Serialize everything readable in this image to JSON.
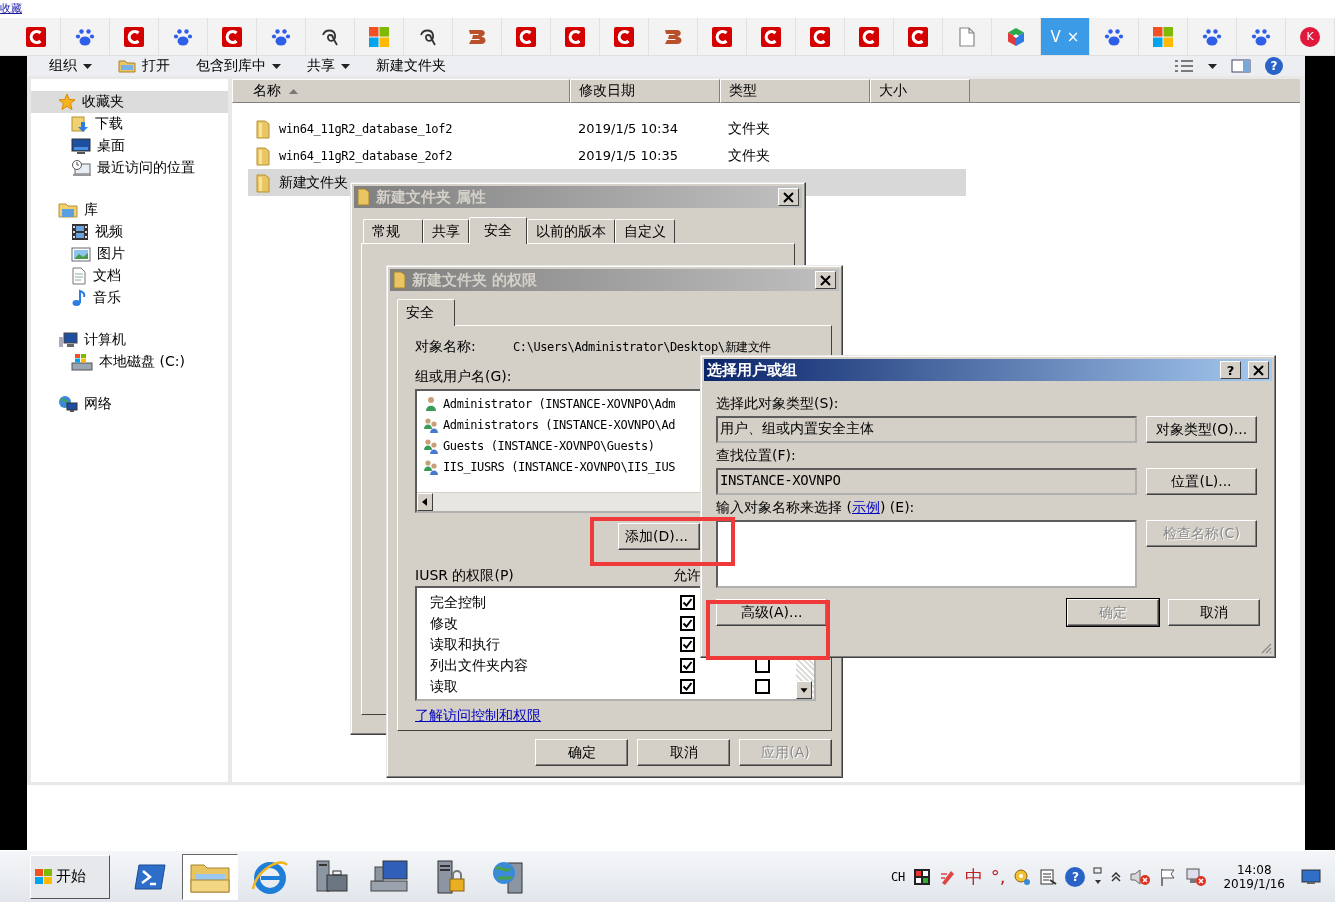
{
  "browser": {
    "top_link": "收藏",
    "tabs": [
      {
        "kind": "ring",
        "selected": false
      },
      {
        "kind": "paw",
        "selected": false
      },
      {
        "kind": "ring",
        "selected": false
      },
      {
        "kind": "paw",
        "selected": false
      },
      {
        "kind": "ring",
        "selected": false
      },
      {
        "kind": "paw",
        "selected": false
      },
      {
        "kind": "swirl",
        "selected": false
      },
      {
        "kind": "squares",
        "selected": false
      },
      {
        "kind": "swirl",
        "selected": false
      },
      {
        "kind": "stripes",
        "selected": false
      },
      {
        "kind": "ring",
        "selected": false
      },
      {
        "kind": "ring",
        "selected": false
      },
      {
        "kind": "ring",
        "selected": false
      },
      {
        "kind": "stripes",
        "selected": false
      },
      {
        "kind": "ring",
        "selected": false
      },
      {
        "kind": "ring",
        "selected": false
      },
      {
        "kind": "ring",
        "selected": false
      },
      {
        "kind": "ring",
        "selected": false
      },
      {
        "kind": "ring",
        "selected": false
      },
      {
        "kind": "doc",
        "selected": false
      },
      {
        "kind": "cube",
        "selected": false
      },
      {
        "kind": "text",
        "label": "V",
        "close": "×",
        "selected": true
      },
      {
        "kind": "paw",
        "selected": false
      },
      {
        "kind": "squares",
        "selected": false
      },
      {
        "kind": "paw",
        "selected": false
      },
      {
        "kind": "paw",
        "selected": false
      },
      {
        "kind": "badge",
        "label": "K",
        "selected": false
      }
    ]
  },
  "explorer": {
    "toolbar": [
      {
        "label": "组织",
        "dropdown": true,
        "icon": false
      },
      {
        "label": "打开",
        "dropdown": false,
        "icon": true
      },
      {
        "label": "包含到库中",
        "dropdown": true,
        "icon": false
      },
      {
        "label": "共享",
        "dropdown": true,
        "icon": false
      },
      {
        "label": "新建文件夹",
        "dropdown": false,
        "icon": false
      }
    ],
    "help": "?",
    "nav": [
      {
        "label": "收藏夹",
        "kind": "star",
        "selected": true,
        "children": [
          {
            "label": "下载",
            "kind": "download",
            "selected": false
          },
          {
            "label": "桌面",
            "kind": "desktop",
            "selected": false
          },
          {
            "label": "最近访问的位置",
            "kind": "recent",
            "selected": false
          }
        ]
      },
      {
        "label": "库",
        "kind": "library",
        "selected": false,
        "children": [
          {
            "label": "视频",
            "kind": "film",
            "selected": false
          },
          {
            "label": "图片",
            "kind": "picture",
            "selected": false
          },
          {
            "label": "文档",
            "kind": "document",
            "selected": false
          },
          {
            "label": "音乐",
            "kind": "music",
            "selected": false
          }
        ]
      },
      {
        "label": "计算机",
        "kind": "computer",
        "selected": false,
        "children": [
          {
            "label": "本地磁盘 (C:)",
            "kind": "drive",
            "selected": false
          }
        ]
      },
      {
        "label": "网络",
        "kind": "network",
        "selected": false
      }
    ],
    "columns": [
      {
        "label": "名称",
        "sorted": true
      },
      {
        "label": "修改日期",
        "sorted": false
      },
      {
        "label": "类型",
        "sorted": false
      },
      {
        "label": "大小",
        "sorted": false
      }
    ],
    "rows": [
      {
        "name": "win64_11gR2_database_1of2",
        "modified": "2019/1/5 10:34",
        "type": "文件夹",
        "selected": false
      },
      {
        "name": "win64_11gR2_database_2of2",
        "modified": "2019/1/5 10:35",
        "type": "文件夹",
        "selected": false
      },
      {
        "name": "新建文件夹",
        "selected": true
      }
    ]
  },
  "properties_dialog": {
    "title": "新建文件夹  属性",
    "tabs": [
      {
        "label": "常规",
        "selected": false
      },
      {
        "label": "共享",
        "selected": false
      },
      {
        "label": "安全",
        "selected": true
      },
      {
        "label": "以前的版本",
        "selected": false
      },
      {
        "label": "自定义",
        "selected": false
      }
    ]
  },
  "permissions_dialog": {
    "title": "新建文件夹 的权限",
    "tabs": [
      {
        "label": "安全",
        "selected": true
      }
    ],
    "object_label": "对象名称:",
    "object_path": "C:\\Users\\Administrator\\Desktop\\新建文件",
    "group_label": "组或用户名(G):",
    "principals": [
      {
        "name": "Administrator (INSTANCE-XOVNPO\\Adm",
        "kind": "user"
      },
      {
        "name": "Administrators (INSTANCE-XOVNPO\\Ad",
        "kind": "group"
      },
      {
        "name": "Guests (INSTANCE-XOVNPO\\Guests)",
        "kind": "group"
      },
      {
        "name": "IIS_IUSRS (INSTANCE-XOVNPO\\IIS_IUS",
        "kind": "group"
      }
    ],
    "add_button": "添加(D)...",
    "permissions_label": "IUSR 的权限(P)",
    "allow_header": "允许",
    "permissions": [
      {
        "name": "完全控制",
        "allow": true
      },
      {
        "name": "修改",
        "allow": true
      },
      {
        "name": "读取和执行",
        "allow": true
      },
      {
        "name": "列出文件夹内容",
        "allow": true,
        "deny": false
      },
      {
        "name": "读取",
        "allow": true,
        "deny": false
      }
    ],
    "link": "了解访问控制和权限",
    "buttons": [
      {
        "label": "确定",
        "disabled": false
      },
      {
        "label": "取消",
        "disabled": false
      },
      {
        "label": "应用(A)",
        "disabled": true
      }
    ]
  },
  "select_dialog": {
    "title": "选择用户或组",
    "help": "?",
    "type_label": "选择此对象类型(S):",
    "type_value": "用户、组或内置安全主体",
    "type_button": "对象类型(O)...",
    "location_label": "查找位置(F):",
    "location_value": "INSTANCE-XOVNPO",
    "location_button": "位置(L)...",
    "names_label_before": "输入对象名称来选择 (",
    "names_link": "示例",
    "names_label_after": ") (E):",
    "check_button": {
      "label": "检查名称(C)",
      "disabled": true
    },
    "advanced_button": "高级(A)...",
    "ok_button": {
      "label": "确定",
      "disabled": true
    },
    "cancel_button": {
      "label": "取消",
      "disabled": false
    }
  },
  "highlight_frames": {
    "around_add_button": true,
    "around_advanced_button": true
  },
  "taskbar": {
    "start": "开始",
    "apps": [
      {
        "kind": "powershell",
        "active": false
      },
      {
        "kind": "folder",
        "active": true
      },
      {
        "kind": "browser",
        "active": false
      },
      {
        "kind": "toolbox",
        "active": false
      },
      {
        "kind": "netpc",
        "active": false
      },
      {
        "kind": "serverlock",
        "active": false
      },
      {
        "kind": "serverglobe",
        "active": false
      }
    ],
    "lang": "CH",
    "ime": "中",
    "punct": "°,",
    "help": "?",
    "time": "14:08",
    "date": "2019/1/16"
  }
}
